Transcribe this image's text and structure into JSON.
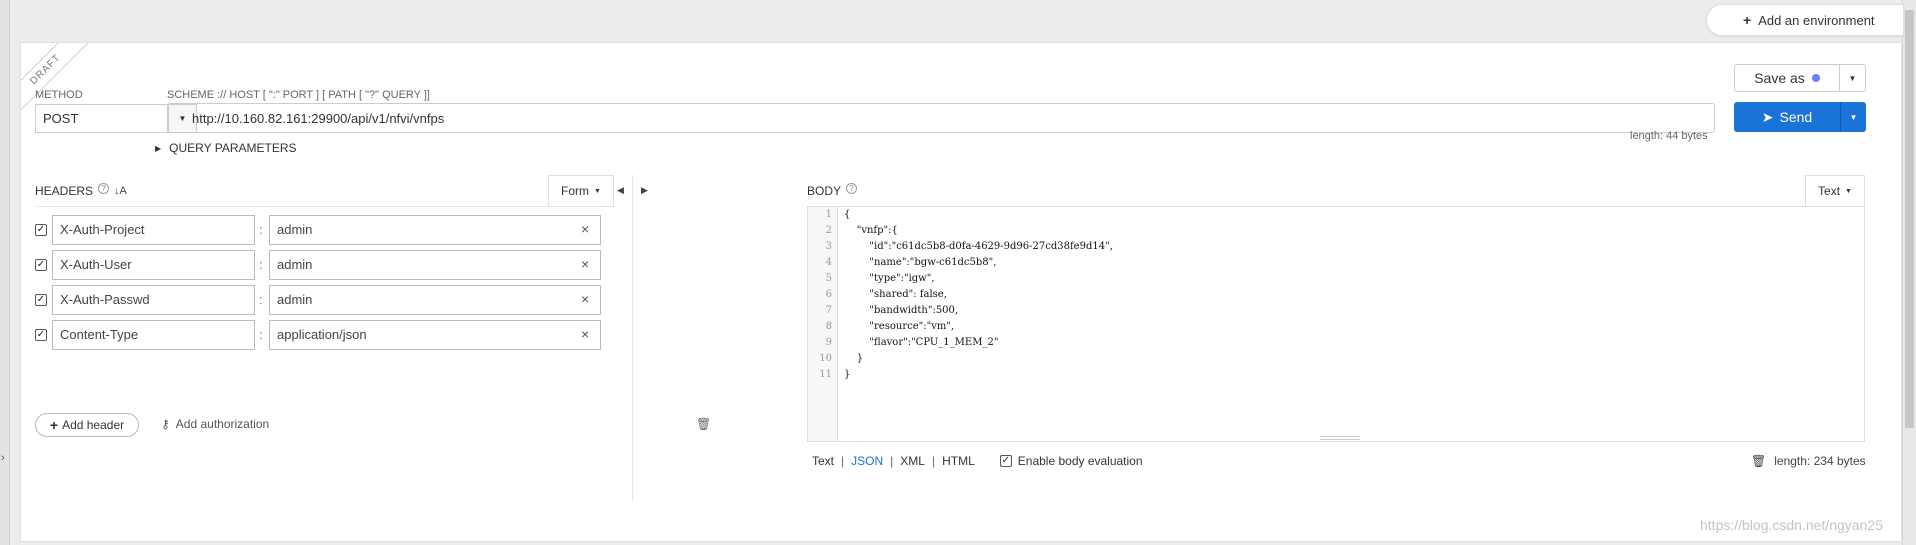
{
  "environment": {
    "add_label": "Add an environment"
  },
  "draft_label": "DRAFT",
  "request": {
    "method_label": "METHOD",
    "method_value": "POST",
    "scheme_label": "SCHEME :// HOST [ \":\" PORT ] [ PATH [ \"?\" QUERY ]]",
    "url": "http://10.160.82.161:29900/api/v1/nfvi/vnfps",
    "url_length": "length: 44 bytes",
    "query_parameters_label": "QUERY PARAMETERS",
    "save_as_label": "Save as",
    "send_label": "Send"
  },
  "headers": {
    "title": "HEADERS",
    "mode_label": "Form",
    "rows": [
      {
        "key": "X-Auth-Project",
        "value": "admin"
      },
      {
        "key": "X-Auth-User",
        "value": "admin"
      },
      {
        "key": "X-Auth-Passwd",
        "value": "admin"
      },
      {
        "key": "Content-Type",
        "value": "application/json"
      }
    ],
    "add_header_label": "Add header",
    "add_authorization_label": "Add authorization"
  },
  "body": {
    "title": "BODY",
    "mode_label": "Text",
    "line_numbers": [
      "1",
      "2",
      "3",
      "4",
      "5",
      "6",
      "7",
      "8",
      "9",
      "10",
      "11"
    ],
    "lines": [
      "{",
      "    \"vnfp\":{",
      "        \"id\":\"c61dc5b8-d0fa-4629-9d96-27cd38fe9d14\",",
      "        \"name\":\"bgw-c61dc5b8\",",
      "        \"type\":\"igw\",",
      "        \"shared\": false,",
      "        \"bandwidth\":500,",
      "        \"resource\":\"vm\",",
      "        \"flavor\":\"CPU_1_MEM_2\"",
      "    }",
      "}"
    ],
    "formats": [
      "Text",
      "JSON",
      "XML",
      "HTML"
    ],
    "active_format": "JSON",
    "enable_evaluation_label": "Enable body evaluation",
    "body_length": "length: 234 bytes"
  },
  "watermark": "https://blog.csdn.net/ngyan25",
  "colors": {
    "accent": "#1a73d9",
    "dot": "#6a7cff"
  }
}
